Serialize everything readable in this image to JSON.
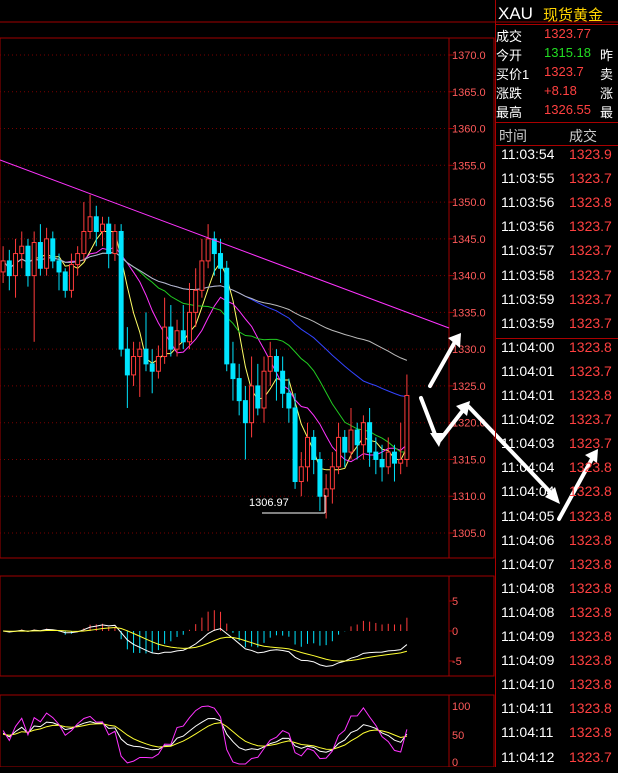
{
  "colors": {
    "up": "#ff3b3b",
    "down": "#00e5ff",
    "grid": "#a00000",
    "axis_text": "#ff5a5a",
    "gain": "#ff4040",
    "open": "#22dd22"
  },
  "quote": {
    "symbol": "XAU",
    "name": "现货黄金",
    "rows": [
      {
        "label": "成交",
        "value": "1323.77",
        "label2": ""
      },
      {
        "label": "今开",
        "value": "1315.18",
        "label2": "昨",
        "color": "#22dd22"
      },
      {
        "label": "买价1",
        "value": "1323.7",
        "label2": "卖"
      },
      {
        "label": "涨跌",
        "value": "+8.18",
        "label2": "涨"
      },
      {
        "label": "最高",
        "value": "1326.55",
        "label2": "最"
      }
    ]
  },
  "ticks": {
    "header_time": "时间",
    "header_price": "成交",
    "rows": [
      {
        "time": "11:03:54",
        "price": "1323.9"
      },
      {
        "time": "11:03:55",
        "price": "1323.7"
      },
      {
        "time": "11:03:56",
        "price": "1323.8"
      },
      {
        "time": "11:03:56",
        "price": "1323.7"
      },
      {
        "time": "11:03:57",
        "price": "1323.7"
      },
      {
        "time": "11:03:58",
        "price": "1323.7"
      },
      {
        "time": "11:03:59",
        "price": "1323.7"
      },
      {
        "time": "11:03:59",
        "price": "1323.7"
      },
      {
        "time": "11:04:00",
        "price": "1323.8"
      },
      {
        "time": "11:04:01",
        "price": "1323.7"
      },
      {
        "time": "11:04:01",
        "price": "1323.8"
      },
      {
        "time": "11:04:02",
        "price": "1323.7"
      },
      {
        "time": "11:04:03",
        "price": "1323.7"
      },
      {
        "time": "11:04:04",
        "price": "1323.8"
      },
      {
        "time": "11:04:04",
        "price": "1323.8"
      },
      {
        "time": "11:04:05",
        "price": "1323.8"
      },
      {
        "time": "11:04:06",
        "price": "1323.8"
      },
      {
        "time": "11:04:07",
        "price": "1323.8"
      },
      {
        "time": "11:04:08",
        "price": "1323.8"
      },
      {
        "time": "11:04:08",
        "price": "1323.8"
      },
      {
        "time": "11:04:09",
        "price": "1323.8"
      },
      {
        "time": "11:04:09",
        "price": "1323.8"
      },
      {
        "time": "11:04:10",
        "price": "1323.8"
      },
      {
        "time": "11:04:11",
        "price": "1323.8"
      },
      {
        "time": "11:04:11",
        "price": "1323.8"
      },
      {
        "time": "11:04:12",
        "price": "1323.7"
      }
    ]
  },
  "price_axis": [
    "1370.0",
    "1365.0",
    "1360.0",
    "1355.0",
    "1350.0",
    "1345.0",
    "1340.0",
    "1335.0",
    "1330.0",
    "1325.0",
    "1320.0",
    "1315.0",
    "1310.0",
    "1305.0"
  ],
  "macd_axis": [
    "5",
    "0",
    "-5"
  ],
  "kdj_axis": [
    "100",
    "50",
    "0"
  ],
  "low_label": "1306.97",
  "candles": [
    {
      "o": 1340.5,
      "c": 1342.0,
      "h": 1344.0,
      "l": 1339.0
    },
    {
      "o": 1342.0,
      "c": 1340.0,
      "h": 1343.5,
      "l": 1338.0
    },
    {
      "o": 1340.0,
      "c": 1343.0,
      "h": 1345.0,
      "l": 1337.0
    },
    {
      "o": 1343.0,
      "c": 1344.0,
      "h": 1346.0,
      "l": 1341.0
    },
    {
      "o": 1344.0,
      "c": 1340.0,
      "h": 1345.0,
      "l": 1338.5
    },
    {
      "o": 1340.0,
      "c": 1344.5,
      "h": 1346.0,
      "l": 1331.0
    },
    {
      "o": 1344.5,
      "c": 1341.0,
      "h": 1347.0,
      "l": 1340.0
    },
    {
      "o": 1341.0,
      "c": 1345.0,
      "h": 1346.5,
      "l": 1340.0
    },
    {
      "o": 1345.0,
      "c": 1342.0,
      "h": 1346.0,
      "l": 1341.0
    },
    {
      "o": 1342.0,
      "c": 1340.5,
      "h": 1343.0,
      "l": 1338.0
    },
    {
      "o": 1340.5,
      "c": 1338.0,
      "h": 1341.0,
      "l": 1337.0
    },
    {
      "o": 1338.0,
      "c": 1341.5,
      "h": 1343.0,
      "l": 1337.0
    },
    {
      "o": 1341.5,
      "c": 1343.0,
      "h": 1344.0,
      "l": 1340.0
    },
    {
      "o": 1343.0,
      "c": 1346.0,
      "h": 1350.0,
      "l": 1342.0
    },
    {
      "o": 1346.0,
      "c": 1348.0,
      "h": 1351.0,
      "l": 1345.0
    },
    {
      "o": 1348.0,
      "c": 1346.0,
      "h": 1349.5,
      "l": 1344.0
    },
    {
      "o": 1346.0,
      "c": 1347.0,
      "h": 1348.0,
      "l": 1344.0
    },
    {
      "o": 1347.0,
      "c": 1343.0,
      "h": 1348.0,
      "l": 1341.0
    },
    {
      "o": 1343.0,
      "c": 1346.0,
      "h": 1347.0,
      "l": 1342.0
    },
    {
      "o": 1346.0,
      "c": 1330.0,
      "h": 1347.0,
      "l": 1329.0
    },
    {
      "o": 1330.0,
      "c": 1326.5,
      "h": 1333.0,
      "l": 1322.0
    },
    {
      "o": 1326.5,
      "c": 1329.0,
      "h": 1331.0,
      "l": 1325.0
    },
    {
      "o": 1329.0,
      "c": 1330.0,
      "h": 1331.0,
      "l": 1323.5
    },
    {
      "o": 1330.0,
      "c": 1328.0,
      "h": 1335.0,
      "l": 1327.0
    },
    {
      "o": 1328.0,
      "c": 1327.0,
      "h": 1330.0,
      "l": 1324.0
    },
    {
      "o": 1327.0,
      "c": 1329.0,
      "h": 1330.5,
      "l": 1326.0
    },
    {
      "o": 1329.0,
      "c": 1333.0,
      "h": 1337.0,
      "l": 1328.0
    },
    {
      "o": 1333.0,
      "c": 1330.0,
      "h": 1336.0,
      "l": 1329.0
    },
    {
      "o": 1330.0,
      "c": 1332.5,
      "h": 1334.0,
      "l": 1329.0
    },
    {
      "o": 1332.5,
      "c": 1331.0,
      "h": 1336.0,
      "l": 1330.0
    },
    {
      "o": 1331.0,
      "c": 1335.0,
      "h": 1339.0,
      "l": 1330.0
    },
    {
      "o": 1335.0,
      "c": 1338.0,
      "h": 1341.0,
      "l": 1333.0
    },
    {
      "o": 1338.0,
      "c": 1342.0,
      "h": 1345.0,
      "l": 1337.0
    },
    {
      "o": 1342.0,
      "c": 1345.0,
      "h": 1347.0,
      "l": 1341.0
    },
    {
      "o": 1345.0,
      "c": 1343.0,
      "h": 1346.0,
      "l": 1340.0
    },
    {
      "o": 1343.0,
      "c": 1341.0,
      "h": 1345.0,
      "l": 1339.0
    },
    {
      "o": 1341.0,
      "c": 1328.0,
      "h": 1342.0,
      "l": 1327.0
    },
    {
      "o": 1328.0,
      "c": 1326.0,
      "h": 1331.0,
      "l": 1323.0
    },
    {
      "o": 1326.0,
      "c": 1323.0,
      "h": 1328.0,
      "l": 1321.0
    },
    {
      "o": 1323.0,
      "c": 1320.0,
      "h": 1325.0,
      "l": 1315.0
    },
    {
      "o": 1320.0,
      "c": 1325.0,
      "h": 1329.0,
      "l": 1318.0
    },
    {
      "o": 1325.0,
      "c": 1322.0,
      "h": 1328.0,
      "l": 1321.0
    },
    {
      "o": 1322.0,
      "c": 1327.0,
      "h": 1329.0,
      "l": 1320.0
    },
    {
      "o": 1327.0,
      "c": 1329.0,
      "h": 1331.0,
      "l": 1325.0
    },
    {
      "o": 1329.0,
      "c": 1327.0,
      "h": 1330.0,
      "l": 1323.0
    },
    {
      "o": 1327.0,
      "c": 1324.0,
      "h": 1329.0,
      "l": 1322.0
    },
    {
      "o": 1324.0,
      "c": 1322.0,
      "h": 1326.0,
      "l": 1320.0
    },
    {
      "o": 1322.0,
      "c": 1312.0,
      "h": 1324.0,
      "l": 1311.0
    },
    {
      "o": 1312.0,
      "c": 1314.0,
      "h": 1316.0,
      "l": 1310.0
    },
    {
      "o": 1314.0,
      "c": 1318.0,
      "h": 1320.0,
      "l": 1312.0
    },
    {
      "o": 1318.0,
      "c": 1315.0,
      "h": 1319.0,
      "l": 1313.0
    },
    {
      "o": 1315.0,
      "c": 1310.0,
      "h": 1316.0,
      "l": 1308.0
    },
    {
      "o": 1310.0,
      "c": 1311.0,
      "h": 1313.0,
      "l": 1306.97
    },
    {
      "o": 1311.0,
      "c": 1314.0,
      "h": 1316.0,
      "l": 1309.0
    },
    {
      "o": 1314.0,
      "c": 1318.0,
      "h": 1320.0,
      "l": 1313.0
    },
    {
      "o": 1318.0,
      "c": 1316.0,
      "h": 1319.0,
      "l": 1314.0
    },
    {
      "o": 1316.0,
      "c": 1319.0,
      "h": 1322.0,
      "l": 1315.0
    },
    {
      "o": 1319.0,
      "c": 1317.0,
      "h": 1320.0,
      "l": 1315.0
    },
    {
      "o": 1317.0,
      "c": 1320.0,
      "h": 1321.0,
      "l": 1315.0
    },
    {
      "o": 1320.0,
      "c": 1316.0,
      "h": 1322.0,
      "l": 1314.0
    },
    {
      "o": 1316.0,
      "c": 1315.0,
      "h": 1318.0,
      "l": 1313.0
    },
    {
      "o": 1315.0,
      "c": 1314.0,
      "h": 1317.0,
      "l": 1312.0
    },
    {
      "o": 1314.0,
      "c": 1316.0,
      "h": 1318.0,
      "l": 1313.0
    },
    {
      "o": 1316.0,
      "c": 1314.5,
      "h": 1317.0,
      "l": 1312.0
    },
    {
      "o": 1314.5,
      "c": 1315.0,
      "h": 1320.0,
      "l": 1313.0
    },
    {
      "o": 1315.0,
      "c": 1323.7,
      "h": 1326.55,
      "l": 1314.0
    }
  ]
}
